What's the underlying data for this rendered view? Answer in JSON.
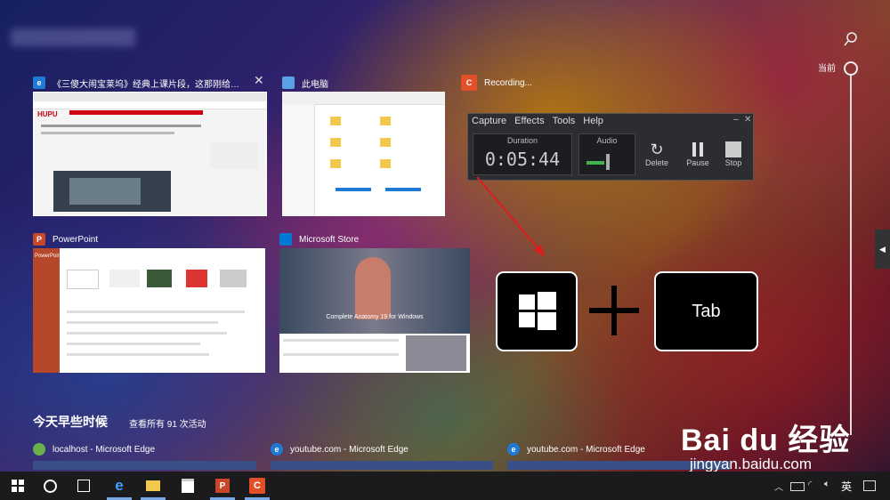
{
  "windows": [
    {
      "title": "《三傻大闹宝莱坞》经典上课片段，这那刚给你...",
      "app": "edge"
    },
    {
      "title": "此电脑",
      "app": "explorer"
    },
    {
      "title": "Recording...",
      "app": "camtasia"
    },
    {
      "title": "PowerPoint",
      "app": "powerpoint"
    },
    {
      "title": "Microsoft Store",
      "app": "store"
    }
  ],
  "thumbnails": {
    "edge_brand": "HUPU",
    "ppt_header": "PowerPoint",
    "store_banner": "Complete Anatomy 19 for Windows"
  },
  "recorder": {
    "menu": [
      "Capture",
      "Effects",
      "Tools",
      "Help"
    ],
    "duration_label": "Duration",
    "duration_value": "0:05:44",
    "audio_label": "Audio",
    "buttons": [
      "Delete",
      "Pause",
      "Stop"
    ]
  },
  "keys": {
    "tab_label": "Tab"
  },
  "timeline": {
    "current_label": "当前",
    "section_title": "今天早些时候",
    "see_all": "查看所有 91 次活动"
  },
  "activities": [
    {
      "label": "localhost - Microsoft Edge"
    },
    {
      "label": "youtube.com - Microsoft Edge"
    },
    {
      "label": "youtube.com - Microsoft Edge"
    }
  ],
  "taskbar": {
    "ime": "英"
  },
  "watermark": {
    "brand": "Bai du 经验",
    "url": "jingyan.baidu.com"
  },
  "colors": {
    "accent": "#1e7ad3",
    "ppt": "#c8472a",
    "camtasia": "#e2502a",
    "store": "#0078d4"
  }
}
